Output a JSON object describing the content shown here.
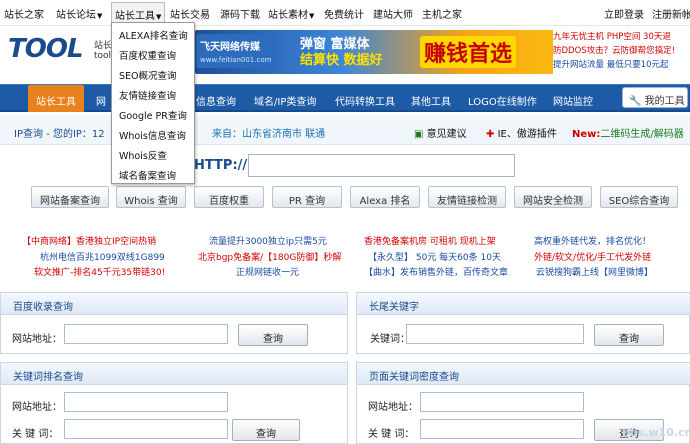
{
  "topnav": {
    "items": [
      "站长之家",
      "站长论坛",
      "站长工具",
      "站长交易",
      "源码下载",
      "站长素材",
      "免费统计",
      "建站大师",
      "主机之家"
    ],
    "login": "立即登录",
    "register": "注册新帐"
  },
  "header": {
    "logo": "TOOL",
    "logo_sub": "站长",
    "logo_sub2": "tool."
  },
  "banner": {
    "site_name": "飞天网络传媒",
    "site_url": "www.feitian001.com",
    "line1": "弹窗 富媒体",
    "line2": "结算快 数据好",
    "big": "赚钱首选"
  },
  "ad_text": [
    "九年无忧主机 PHP空间 30天退",
    "防DDOS攻击？云防御帮您搞定!",
    "提升网站流量 最低只要10元起"
  ],
  "menubar": {
    "items": [
      "站长工具",
      "网",
      "信息查询",
      "域名/IP类查询",
      "代码转换工具",
      "其他工具",
      "LOGO在线制作",
      "网站监控"
    ],
    "my_tools": "我的工具"
  },
  "infobar": {
    "ip_query": "IP查询 - 您的IP：12",
    "location": "来自：山东省济南市 联通",
    "feedback": "意见建议",
    "plugin": "IE、傲游插件",
    "new_label": "New:",
    "new_text": "二维码生成/解码器"
  },
  "url": {
    "label": "HTTP://",
    "value": ""
  },
  "tool_buttons": [
    "网站备案查询",
    "Whois 查询",
    "百度权重",
    "PR 查询",
    "Alexa 排名",
    "友情链接检测",
    "网站安全检测",
    "SEO综合查询"
  ],
  "ads": {
    "col1": [
      "【中商网络】香港独立IP空间热销",
      "杭州电信百兆1099双线1G899",
      "软文推广-排名45千元35带链30!"
    ],
    "col2": [
      "流量提升3000独立ip只需5元",
      "北京bgp免备案/【180G防御】秒解",
      "正规网链收一元"
    ],
    "col3": [
      "香港免备案机房 可租机 现机上架",
      "【永久型】 50元 每天60条 10天",
      "【曲水】发布销售外链，百传奇文章"
    ],
    "col4": [
      "高权重外链代发，排名优化！",
      "外链/软文/优化/手工代发外链",
      "云锐搜狗霸上线【网里微博】"
    ]
  },
  "panels": {
    "baidu": {
      "title": "百度收录查询",
      "label": "网站地址：",
      "button": "查询"
    },
    "longtail": {
      "title": "长尾关键字",
      "label": "关键词：",
      "button": "查询"
    },
    "keyword_rank": {
      "title": "关键词排名查询",
      "label1": "网站地址：",
      "label2": "关 键 词：",
      "button": "查询"
    },
    "density": {
      "title": "页面关键词密度查询",
      "label1": "网站地址：",
      "label2": "关 键 词：",
      "button": "查询"
    }
  },
  "dropdown": {
    "items": [
      "ALEXA排名查询",
      "百度权重查询",
      "SEO概况查询",
      "友情链接查询",
      "Google PR查询",
      "Whois信息查询",
      "Whois反查",
      "域名备案查询"
    ]
  },
  "watermark": "bbs.w10.cn",
  "colors": {
    "menubar": "#1d5ba7",
    "active_menu": "#e9811c",
    "ad_red": "#d40000",
    "panel_title": "#1a4b8c"
  }
}
